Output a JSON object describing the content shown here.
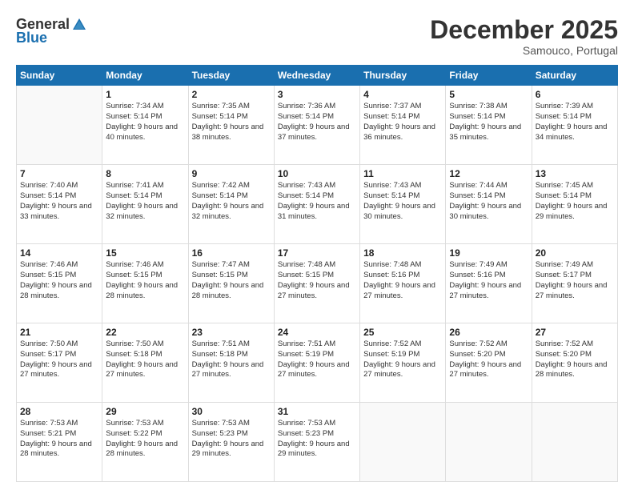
{
  "logo": {
    "general": "General",
    "blue": "Blue"
  },
  "title": "December 2025",
  "subtitle": "Samouco, Portugal",
  "days_of_week": [
    "Sunday",
    "Monday",
    "Tuesday",
    "Wednesday",
    "Thursday",
    "Friday",
    "Saturday"
  ],
  "weeks": [
    [
      {
        "day": "",
        "sunrise": "",
        "sunset": "",
        "daylight": ""
      },
      {
        "day": "1",
        "sunrise": "Sunrise: 7:34 AM",
        "sunset": "Sunset: 5:14 PM",
        "daylight": "Daylight: 9 hours and 40 minutes."
      },
      {
        "day": "2",
        "sunrise": "Sunrise: 7:35 AM",
        "sunset": "Sunset: 5:14 PM",
        "daylight": "Daylight: 9 hours and 38 minutes."
      },
      {
        "day": "3",
        "sunrise": "Sunrise: 7:36 AM",
        "sunset": "Sunset: 5:14 PM",
        "daylight": "Daylight: 9 hours and 37 minutes."
      },
      {
        "day": "4",
        "sunrise": "Sunrise: 7:37 AM",
        "sunset": "Sunset: 5:14 PM",
        "daylight": "Daylight: 9 hours and 36 minutes."
      },
      {
        "day": "5",
        "sunrise": "Sunrise: 7:38 AM",
        "sunset": "Sunset: 5:14 PM",
        "daylight": "Daylight: 9 hours and 35 minutes."
      },
      {
        "day": "6",
        "sunrise": "Sunrise: 7:39 AM",
        "sunset": "Sunset: 5:14 PM",
        "daylight": "Daylight: 9 hours and 34 minutes."
      }
    ],
    [
      {
        "day": "7",
        "sunrise": "Sunrise: 7:40 AM",
        "sunset": "Sunset: 5:14 PM",
        "daylight": "Daylight: 9 hours and 33 minutes."
      },
      {
        "day": "8",
        "sunrise": "Sunrise: 7:41 AM",
        "sunset": "Sunset: 5:14 PM",
        "daylight": "Daylight: 9 hours and 32 minutes."
      },
      {
        "day": "9",
        "sunrise": "Sunrise: 7:42 AM",
        "sunset": "Sunset: 5:14 PM",
        "daylight": "Daylight: 9 hours and 32 minutes."
      },
      {
        "day": "10",
        "sunrise": "Sunrise: 7:43 AM",
        "sunset": "Sunset: 5:14 PM",
        "daylight": "Daylight: 9 hours and 31 minutes."
      },
      {
        "day": "11",
        "sunrise": "Sunrise: 7:43 AM",
        "sunset": "Sunset: 5:14 PM",
        "daylight": "Daylight: 9 hours and 30 minutes."
      },
      {
        "day": "12",
        "sunrise": "Sunrise: 7:44 AM",
        "sunset": "Sunset: 5:14 PM",
        "daylight": "Daylight: 9 hours and 30 minutes."
      },
      {
        "day": "13",
        "sunrise": "Sunrise: 7:45 AM",
        "sunset": "Sunset: 5:14 PM",
        "daylight": "Daylight: 9 hours and 29 minutes."
      }
    ],
    [
      {
        "day": "14",
        "sunrise": "Sunrise: 7:46 AM",
        "sunset": "Sunset: 5:15 PM",
        "daylight": "Daylight: 9 hours and 28 minutes."
      },
      {
        "day": "15",
        "sunrise": "Sunrise: 7:46 AM",
        "sunset": "Sunset: 5:15 PM",
        "daylight": "Daylight: 9 hours and 28 minutes."
      },
      {
        "day": "16",
        "sunrise": "Sunrise: 7:47 AM",
        "sunset": "Sunset: 5:15 PM",
        "daylight": "Daylight: 9 hours and 28 minutes."
      },
      {
        "day": "17",
        "sunrise": "Sunrise: 7:48 AM",
        "sunset": "Sunset: 5:15 PM",
        "daylight": "Daylight: 9 hours and 27 minutes."
      },
      {
        "day": "18",
        "sunrise": "Sunrise: 7:48 AM",
        "sunset": "Sunset: 5:16 PM",
        "daylight": "Daylight: 9 hours and 27 minutes."
      },
      {
        "day": "19",
        "sunrise": "Sunrise: 7:49 AM",
        "sunset": "Sunset: 5:16 PM",
        "daylight": "Daylight: 9 hours and 27 minutes."
      },
      {
        "day": "20",
        "sunrise": "Sunrise: 7:49 AM",
        "sunset": "Sunset: 5:17 PM",
        "daylight": "Daylight: 9 hours and 27 minutes."
      }
    ],
    [
      {
        "day": "21",
        "sunrise": "Sunrise: 7:50 AM",
        "sunset": "Sunset: 5:17 PM",
        "daylight": "Daylight: 9 hours and 27 minutes."
      },
      {
        "day": "22",
        "sunrise": "Sunrise: 7:50 AM",
        "sunset": "Sunset: 5:18 PM",
        "daylight": "Daylight: 9 hours and 27 minutes."
      },
      {
        "day": "23",
        "sunrise": "Sunrise: 7:51 AM",
        "sunset": "Sunset: 5:18 PM",
        "daylight": "Daylight: 9 hours and 27 minutes."
      },
      {
        "day": "24",
        "sunrise": "Sunrise: 7:51 AM",
        "sunset": "Sunset: 5:19 PM",
        "daylight": "Daylight: 9 hours and 27 minutes."
      },
      {
        "day": "25",
        "sunrise": "Sunrise: 7:52 AM",
        "sunset": "Sunset: 5:19 PM",
        "daylight": "Daylight: 9 hours and 27 minutes."
      },
      {
        "day": "26",
        "sunrise": "Sunrise: 7:52 AM",
        "sunset": "Sunset: 5:20 PM",
        "daylight": "Daylight: 9 hours and 27 minutes."
      },
      {
        "day": "27",
        "sunrise": "Sunrise: 7:52 AM",
        "sunset": "Sunset: 5:20 PM",
        "daylight": "Daylight: 9 hours and 28 minutes."
      }
    ],
    [
      {
        "day": "28",
        "sunrise": "Sunrise: 7:53 AM",
        "sunset": "Sunset: 5:21 PM",
        "daylight": "Daylight: 9 hours and 28 minutes."
      },
      {
        "day": "29",
        "sunrise": "Sunrise: 7:53 AM",
        "sunset": "Sunset: 5:22 PM",
        "daylight": "Daylight: 9 hours and 28 minutes."
      },
      {
        "day": "30",
        "sunrise": "Sunrise: 7:53 AM",
        "sunset": "Sunset: 5:23 PM",
        "daylight": "Daylight: 9 hours and 29 minutes."
      },
      {
        "day": "31",
        "sunrise": "Sunrise: 7:53 AM",
        "sunset": "Sunset: 5:23 PM",
        "daylight": "Daylight: 9 hours and 29 minutes."
      },
      {
        "day": "",
        "sunrise": "",
        "sunset": "",
        "daylight": ""
      },
      {
        "day": "",
        "sunrise": "",
        "sunset": "",
        "daylight": ""
      },
      {
        "day": "",
        "sunrise": "",
        "sunset": "",
        "daylight": ""
      }
    ]
  ]
}
